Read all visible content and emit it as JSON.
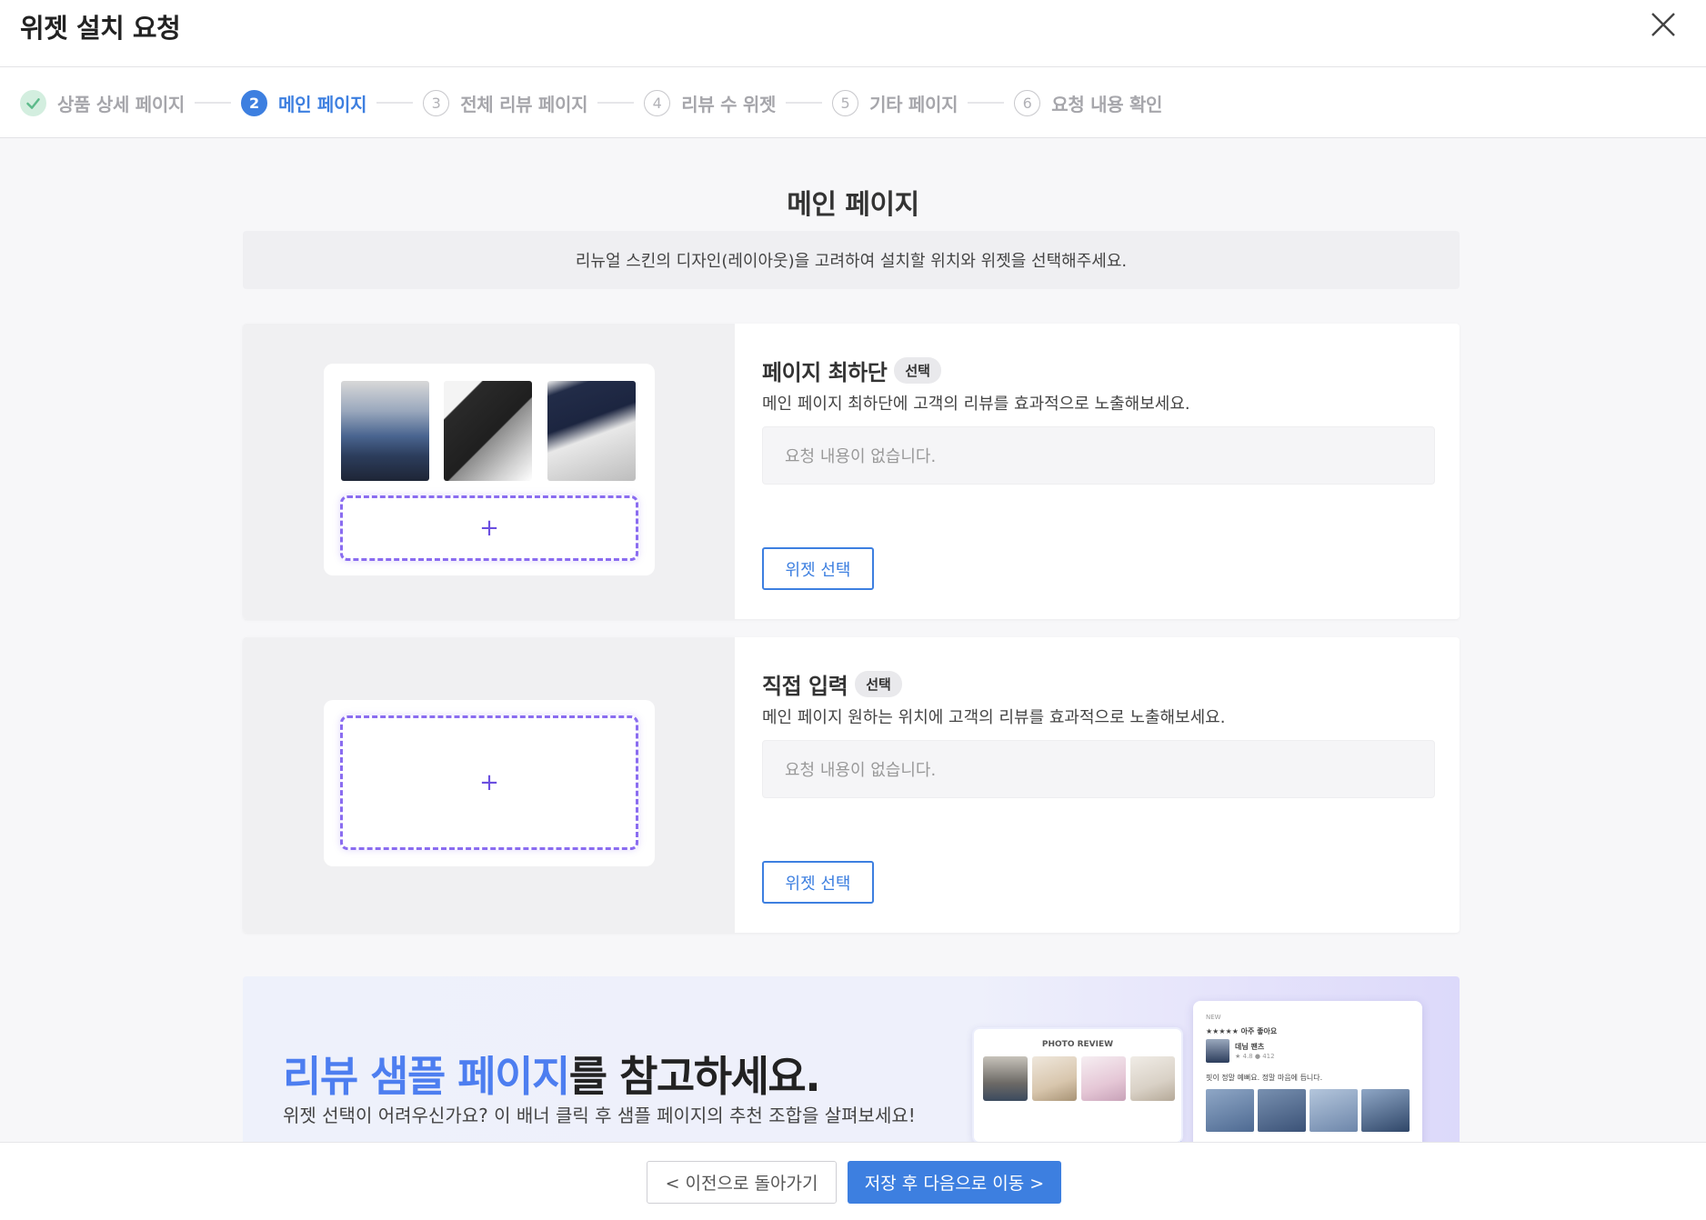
{
  "header": {
    "title": "위젯 설치 요청"
  },
  "stepper": {
    "steps": [
      {
        "number": "1",
        "label": "상품 상세 페이지",
        "state": "done"
      },
      {
        "number": "2",
        "label": "메인 페이지",
        "state": "active"
      },
      {
        "number": "3",
        "label": "전체 리뷰 페이지",
        "state": "pending"
      },
      {
        "number": "4",
        "label": "리뷰 수 위젯",
        "state": "pending"
      },
      {
        "number": "5",
        "label": "기타 페이지",
        "state": "pending"
      },
      {
        "number": "6",
        "label": "요청 내용 확인",
        "state": "pending"
      }
    ]
  },
  "main": {
    "title": "메인 페이지",
    "notice": "리뉴얼 스킨의 디자인(레이아웃)을 고려하여 설치할 위치와 위젯을 선택해주세요.",
    "sections": [
      {
        "title": "페이지 최하단",
        "badge": "선택",
        "description": "메인 페이지 최하단에 고객의 리뷰를 효과적으로 노출해보세요.",
        "empty_text": "요청 내용이 없습니다.",
        "button_label": "위젯 선택",
        "add_symbol": "+"
      },
      {
        "title": "직접 입력",
        "badge": "선택",
        "description": "메인 페이지 원하는 위치에 고객의 리뷰를 효과적으로 노출해보세요.",
        "empty_text": "요청 내용이 없습니다.",
        "button_label": "위젯 선택",
        "add_symbol": "+"
      }
    ]
  },
  "banner": {
    "title_highlight": "리뷰 샘플 페이지",
    "title_rest": "를 참고하세요.",
    "subtitle": "위젯 선택이 어려우신가요? 이 배너 클릭 후 샘플 페이지의 추천 조합을 살펴보세요!",
    "mock_photo_label": "PHOTO REVIEW",
    "mock_new": "NEW",
    "mock_rating": "★★★★★ 아주 좋아요",
    "mock_product": "데님 팬츠",
    "mock_stats": "★ 4.8  ● 412",
    "mock_review": "핏이 정말 예뻐요. 정말 마음에 듭니다."
  },
  "footer": {
    "prev_label": "< 이전으로 돌아가기",
    "next_label": "저장 후 다음으로 이동 >"
  },
  "colors": {
    "accent": "#3d7fe0",
    "dashed": "#8a6cf0",
    "done": "#5cba8a"
  }
}
